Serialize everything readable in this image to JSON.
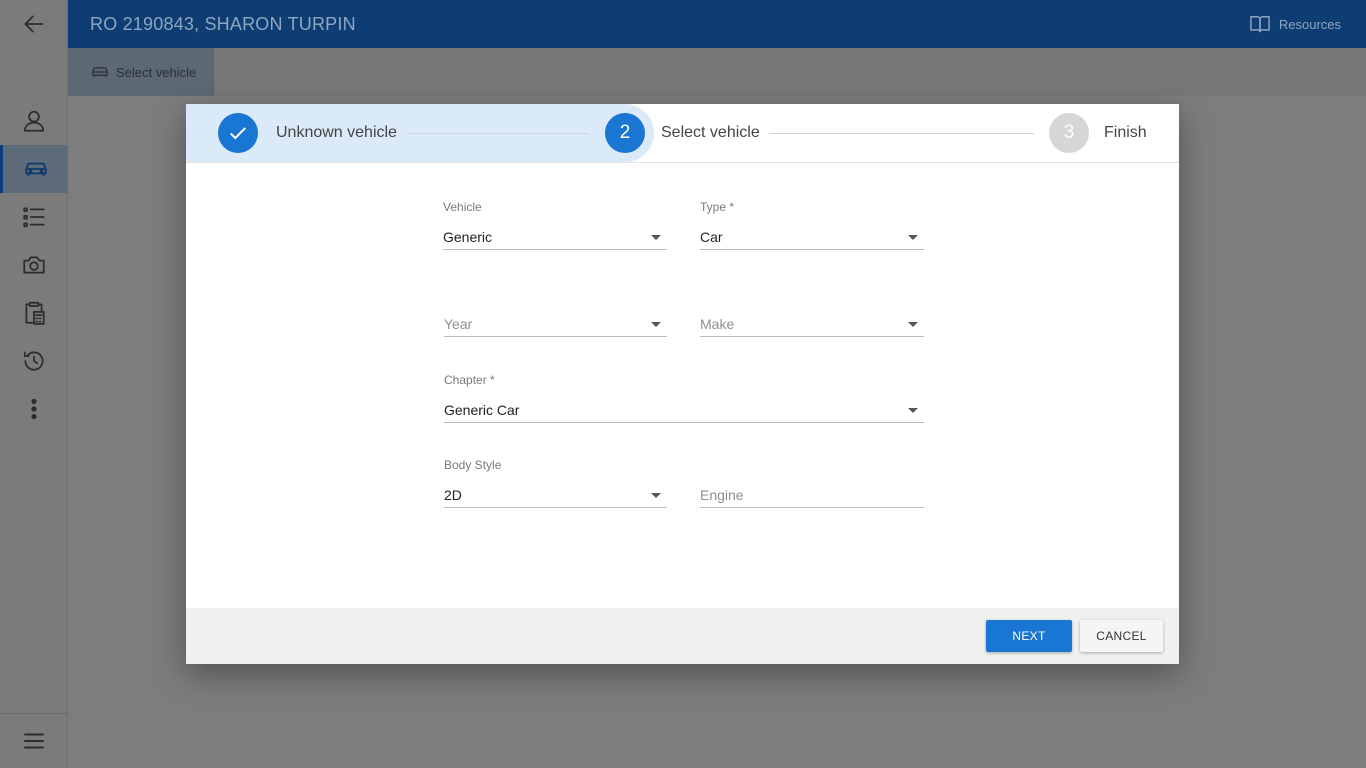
{
  "header": {
    "title": "RO 2190843, SHARON TURPIN",
    "resources_label": "Resources"
  },
  "tabs": {
    "select_vehicle_label": "Select vehicle"
  },
  "stepper": {
    "steps": [
      {
        "label": "Unknown vehicle",
        "state": "completed"
      },
      {
        "number": "2",
        "label": "Select vehicle",
        "state": "active"
      },
      {
        "number": "3",
        "label": "Finish",
        "state": "pending"
      }
    ]
  },
  "form": {
    "vehicle": {
      "label": "Vehicle",
      "value": "Generic"
    },
    "type": {
      "label": "Type *",
      "value": "Car"
    },
    "year": {
      "placeholder": "Year"
    },
    "make": {
      "placeholder": "Make"
    },
    "chapter": {
      "label": "Chapter *",
      "value": "Generic Car"
    },
    "body_style": {
      "label": "Body Style",
      "value": "2D"
    },
    "engine": {
      "placeholder": "Engine"
    }
  },
  "footer": {
    "next_label": "NEXT",
    "cancel_label": "CANCEL"
  },
  "colors": {
    "header": "#0d3d73",
    "primary": "#1976d2",
    "step_pending": "#d6d6d6",
    "step_highlight": "#dbeaf8"
  }
}
